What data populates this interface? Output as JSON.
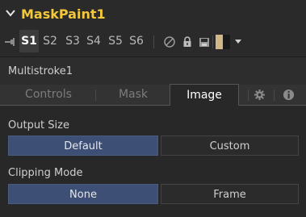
{
  "header": {
    "title": "MaskPaint1",
    "expand_icon": "chevron-down-icon"
  },
  "toolbar": {
    "pin_icon": "pin-icon",
    "views": [
      "S1",
      "S2",
      "S3",
      "S4",
      "S5",
      "S6"
    ],
    "active_view": "S1",
    "icons": [
      "disable-icon",
      "lock-icon",
      "save-icon"
    ],
    "color_swatch": {
      "left": "#d1b88a",
      "right": "#1a1a1a"
    },
    "dropdown_icon": "caret-down-icon"
  },
  "subtitle": "Multistroke1",
  "tabs": {
    "items": [
      "Controls",
      "Mask",
      "Image"
    ],
    "active": "Image",
    "icons": [
      "settings-icon",
      "info-icon"
    ]
  },
  "output_size": {
    "label": "Output Size",
    "options": [
      "Default",
      "Custom"
    ],
    "selected": "Default"
  },
  "clipping_mode": {
    "label": "Clipping Mode",
    "options": [
      "None",
      "Frame"
    ],
    "selected": "None"
  },
  "colors": {
    "title": "#f3c83a",
    "selected_button": "#3e4f75"
  }
}
